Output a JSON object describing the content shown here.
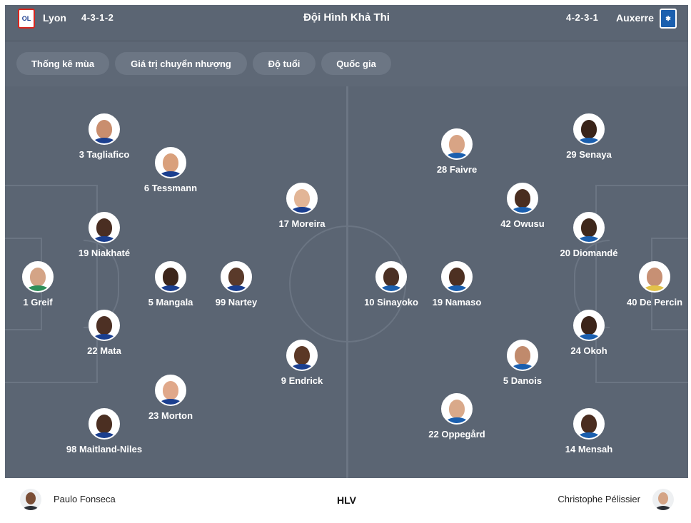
{
  "header": {
    "home_team": "Lyon",
    "home_formation": "4-3-1-2",
    "title": "Đội Hình Khả Thi",
    "away_formation": "4-2-3-1",
    "away_team": "Auxerre",
    "home_crest_text": "OL",
    "away_crest_text": "✱"
  },
  "tabs": [
    {
      "label": "Thống kê mùa"
    },
    {
      "label": "Giá trị chuyển nhượng"
    },
    {
      "label": "Độ tuổi"
    },
    {
      "label": "Quốc gia"
    }
  ],
  "home_players": [
    {
      "label": "3 Tagliafico",
      "skin": "#c98e6e"
    },
    {
      "label": "6 Tessmann",
      "skin": "#d9a07c"
    },
    {
      "label": "17 Moreira",
      "skin": "#e2b596"
    },
    {
      "label": "19 Niakhaté",
      "skin": "#4a2e22"
    },
    {
      "label": "1 Greif",
      "skin": "#d4a486"
    },
    {
      "label": "5 Mangala",
      "skin": "#3d261b"
    },
    {
      "label": "99 Nartey",
      "skin": "#5a3a2a"
    },
    {
      "label": "22 Mata",
      "skin": "#4d3024"
    },
    {
      "label": "9 Endrick",
      "skin": "#5b3826"
    },
    {
      "label": "23 Morton",
      "skin": "#e0a88a"
    },
    {
      "label": "98 Maitland-Niles",
      "skin": "#4b2f22"
    }
  ],
  "away_players": [
    {
      "label": "28 Faivre",
      "skin": "#d8a485"
    },
    {
      "label": "29 Senaya",
      "skin": "#3a2419"
    },
    {
      "label": "42 Owusu",
      "skin": "#4a2e20"
    },
    {
      "label": "20 Diomandé",
      "skin": "#3f281c"
    },
    {
      "label": "10 Sinayoko",
      "skin": "#4b3024"
    },
    {
      "label": "19 Namaso",
      "skin": "#4d3022"
    },
    {
      "label": "40 De Percin",
      "skin": "#c79074"
    },
    {
      "label": "24 Okoh",
      "skin": "#3c251a"
    },
    {
      "label": "5 Danois",
      "skin": "#c08a6c"
    },
    {
      "label": "22 Oppegård",
      "skin": "#d9a98a"
    },
    {
      "label": "14 Mensah",
      "skin": "#4a2d20"
    }
  ],
  "footer": {
    "home_coach": "Paulo Fonseca",
    "label": "HLV",
    "away_coach": "Christophe Pélissier"
  },
  "colors": {
    "pitch": "#5b6573",
    "lines": "#6b7583",
    "tab": "#6c7684"
  }
}
